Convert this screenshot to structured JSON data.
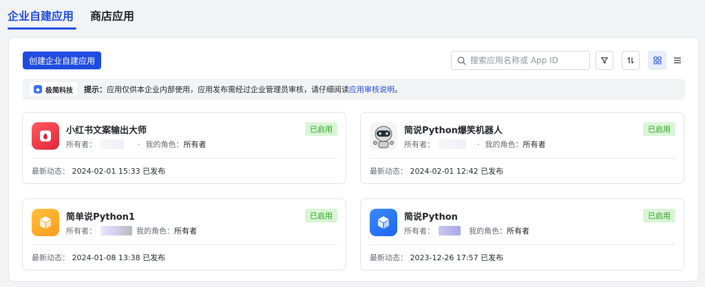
{
  "tabs": [
    {
      "label": "企业自建应用",
      "active": true
    },
    {
      "label": "商店应用",
      "active": false
    }
  ],
  "toolbar": {
    "create_label": "创建企业自建应用",
    "search_placeholder": "搜索应用名称或 App ID",
    "icons": [
      "filter-icon",
      "sort-icon",
      "grid-view-icon",
      "list-view-icon"
    ]
  },
  "notice": {
    "tenant": "极简科技",
    "label": "提示：",
    "text": "应用仅供本企业内部使用，应用发布需经过企业管理员审核，请仔细阅读",
    "link": "应用审核说明",
    "end": "。"
  },
  "colors": {
    "accent": "#1f4be0",
    "status_bg": "#d9f5d6",
    "status_text": "#2ea121"
  },
  "cards": [
    {
      "name": "小红书文案输出大师",
      "status": "已启用",
      "owner_label": "所有者：",
      "role_label": "我的角色：",
      "role": "所有者",
      "activity_label": "最新动态：",
      "activity": "2024-02-01 15:33 已发布",
      "icon": "red-note-icon"
    },
    {
      "name": "简说Python爆笑机器人",
      "status": "已启用",
      "owner_label": "所有者：",
      "role_label": "我的角色：",
      "role": "所有者",
      "activity_label": "最新动态：",
      "activity": "2024-02-01 12:42 已发布",
      "icon": "robot-avatar-icon"
    },
    {
      "name": "简单说Python1",
      "status": "已启用",
      "owner_label": "所有者：",
      "role_label": "我的角色：",
      "role": "所有者",
      "activity_label": "最新动态：",
      "activity": "2024-01-08 13:38 已发布",
      "icon": "orange-cube-icon"
    },
    {
      "name": "简说Python",
      "status": "已启用",
      "owner_label": "所有者：",
      "role_label": "我的角色：",
      "role": "所有者",
      "activity_label": "最新动态：",
      "activity": "2023-12-26 17:57 已发布",
      "icon": "blue-cube-icon"
    }
  ]
}
